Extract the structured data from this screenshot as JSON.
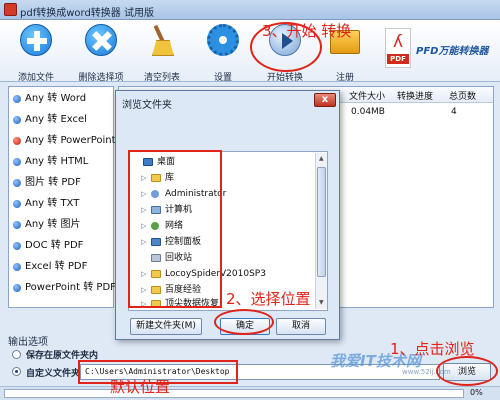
{
  "window": {
    "title": "pdf转换成word转换器 试用版"
  },
  "toolbar": {
    "add_label": "添加文件",
    "delete_label": "删除选择项",
    "clear_label": "清空列表",
    "settings_label": "设置",
    "start_label": "开始转换",
    "register_label": "注册",
    "brand_text": "PFD万能转换器",
    "logo_text": "PDF"
  },
  "formats": [
    {
      "label": "Any 转 Word",
      "selected": false
    },
    {
      "label": "Any 转 Excel",
      "selected": false
    },
    {
      "label": "Any 转 PowerPoint",
      "selected": true
    },
    {
      "label": "Any 转 HTML",
      "selected": false
    },
    {
      "label": "图片 转 PDF",
      "selected": false
    },
    {
      "label": "Any 转 TXT",
      "selected": false
    },
    {
      "label": "Any 转 图片",
      "selected": false
    },
    {
      "label": "DOC 转 PDF",
      "selected": false
    },
    {
      "label": "Excel 转 PDF",
      "selected": false
    },
    {
      "label": "PowerPoint 转 PDF",
      "selected": false
    }
  ],
  "table": {
    "headers": [
      "文件大小",
      "转换进度",
      "总页数"
    ],
    "rows": [
      {
        "size": "0.04MB",
        "progress": "",
        "pages": "4"
      }
    ]
  },
  "output": {
    "section_title": "输出选项",
    "option_source": "保存在原文件夹内",
    "option_custom": "自定义文件夹",
    "path": "C:\\Users\\Administrator\\Desktop",
    "browse_label": "浏览"
  },
  "status": {
    "progress_text": "0%",
    "progress": 0
  },
  "dialog": {
    "title": "浏览文件夹",
    "close_label": "x",
    "tree": [
      {
        "label": "桌面",
        "icon": "desktop-icon",
        "indent": 0,
        "arrow": ""
      },
      {
        "label": "库",
        "icon": "library-folder-icon",
        "indent": 1,
        "arrow": "▷"
      },
      {
        "label": "Administrator",
        "icon": "user-icon",
        "indent": 1,
        "arrow": "▷"
      },
      {
        "label": "计算机",
        "icon": "computer-icon",
        "indent": 1,
        "arrow": "▷"
      },
      {
        "label": "网络",
        "icon": "network-icon",
        "indent": 1,
        "arrow": "▷"
      },
      {
        "label": "控制面板",
        "icon": "control-panel-icon",
        "indent": 1,
        "arrow": "▷"
      },
      {
        "label": "回收站",
        "icon": "recycle-bin-icon",
        "indent": 1,
        "arrow": ""
      },
      {
        "label": "LocoySpiderV2010SP3",
        "icon": "folder-icon",
        "indent": 1,
        "arrow": "▷"
      },
      {
        "label": "百度经验",
        "icon": "folder-icon",
        "indent": 1,
        "arrow": "▷"
      },
      {
        "label": "顶尖数据恢复",
        "icon": "folder-icon",
        "indent": 1,
        "arrow": "▷"
      }
    ],
    "new_folder_label": "新建文件夹(M)",
    "ok_label": "确定",
    "cancel_label": "取消"
  },
  "annotations": {
    "step1": "1、点击浏览",
    "step2": "2、选择位置",
    "step3": "3、开始 转换",
    "default_location": "默认位置"
  },
  "watermark": {
    "main": "我爱IT技术网",
    "sub": "www.52ij.com"
  },
  "colors": {
    "annotation": "#e0241a",
    "accent": "#1a7ad8",
    "brand": "#1e56a0"
  }
}
